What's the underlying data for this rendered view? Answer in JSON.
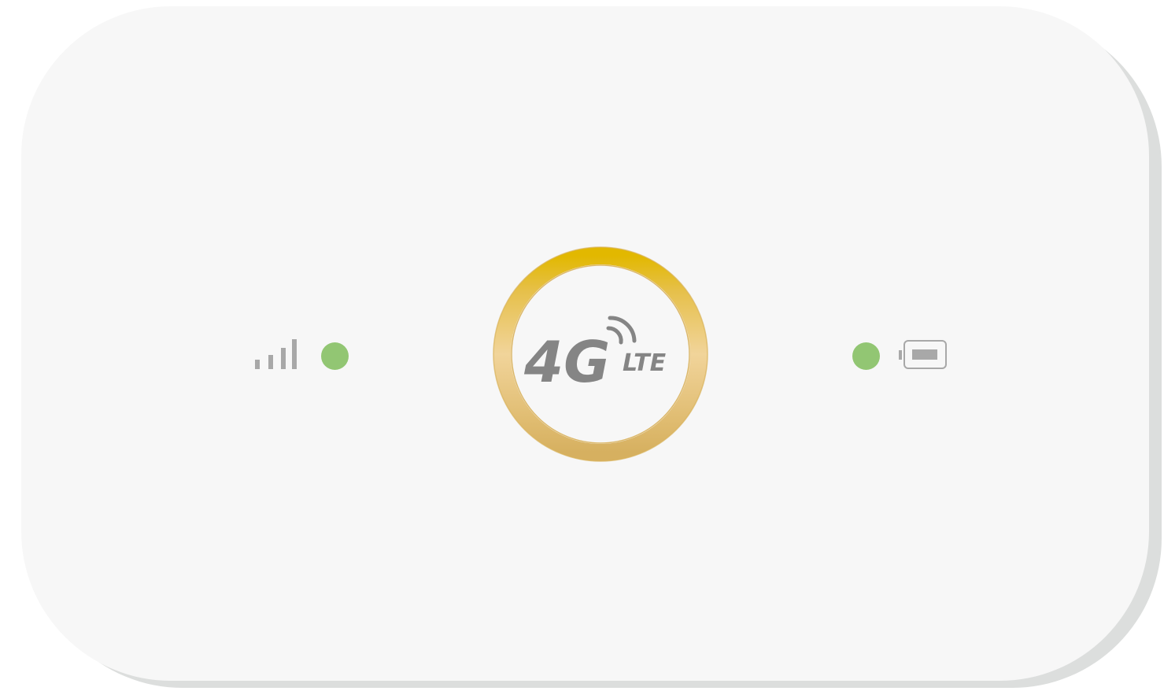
{
  "device": {
    "logo": {
      "main": "4G",
      "sub": "LTE"
    },
    "signal": {
      "bars_total": 4,
      "icon": "signal-bars-icon"
    },
    "battery": {
      "icon": "battery-icon"
    },
    "indicators": {
      "left_led_color": "#92c673",
      "right_led_color": "#92c673"
    },
    "colors": {
      "body": "#f7f7f7",
      "shadow": "#dcdedd",
      "ring_top": "#e2b800",
      "ring_mid": "#f1d49a",
      "ring_bottom": "#d9b463",
      "icon_gray": "#a8a8a8",
      "logo_gray": "#858585"
    }
  }
}
